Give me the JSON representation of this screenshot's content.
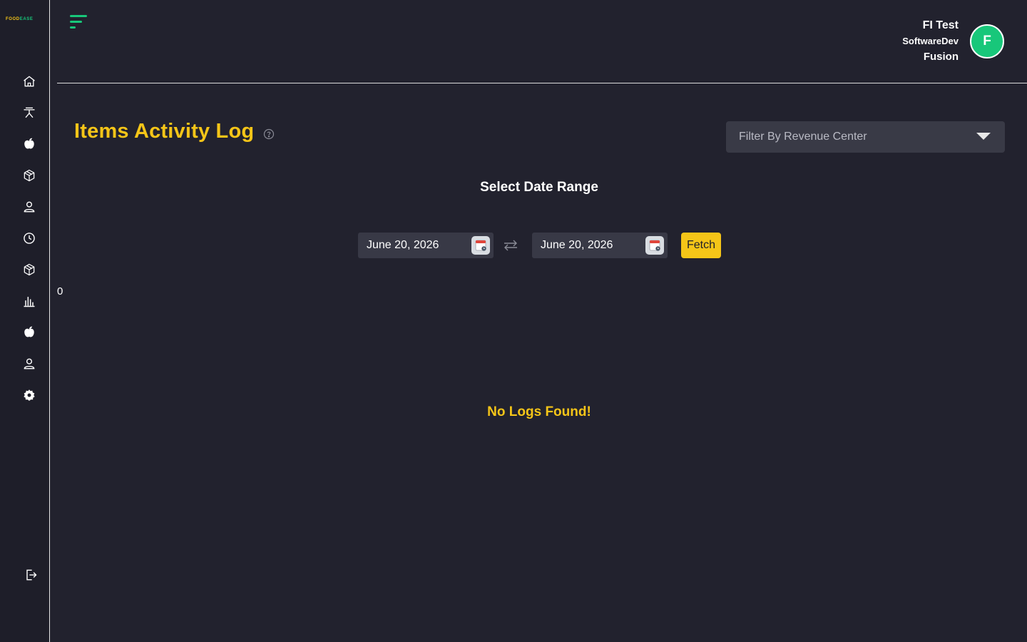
{
  "brand": {
    "food": "FOOD",
    "ease": "EASE"
  },
  "sidebar": {
    "items": [
      {
        "icon": "home-icon"
      },
      {
        "icon": "dining-table-icon"
      },
      {
        "icon": "apple-icon"
      },
      {
        "icon": "box-icon"
      },
      {
        "icon": "user-icon"
      },
      {
        "icon": "clock-icon"
      },
      {
        "icon": "box-icon"
      },
      {
        "icon": "bar-chart-icon"
      },
      {
        "icon": "apple-icon"
      },
      {
        "icon": "user-icon"
      },
      {
        "icon": "gear-icon"
      }
    ],
    "logout_icon": "logout-icon"
  },
  "user": {
    "name": "FI Test",
    "org": "SoftwareDev",
    "location": "Fusion",
    "avatar_initial": "F"
  },
  "page": {
    "title": "Items Activity Log",
    "revenue_filter_placeholder": "Filter By Revenue Center",
    "date_range_title": "Select Date Range",
    "start_date": "June 20, 2026",
    "end_date": "June 20, 2026",
    "fetch_label": "Fetch",
    "count": "0",
    "empty_message": "No Logs Found!"
  },
  "colors": {
    "accent": "#f5c518",
    "brand_green": "#18c77a",
    "background": "#22222e",
    "sidebar": "#1e1e29",
    "input_bg": "#383946"
  }
}
